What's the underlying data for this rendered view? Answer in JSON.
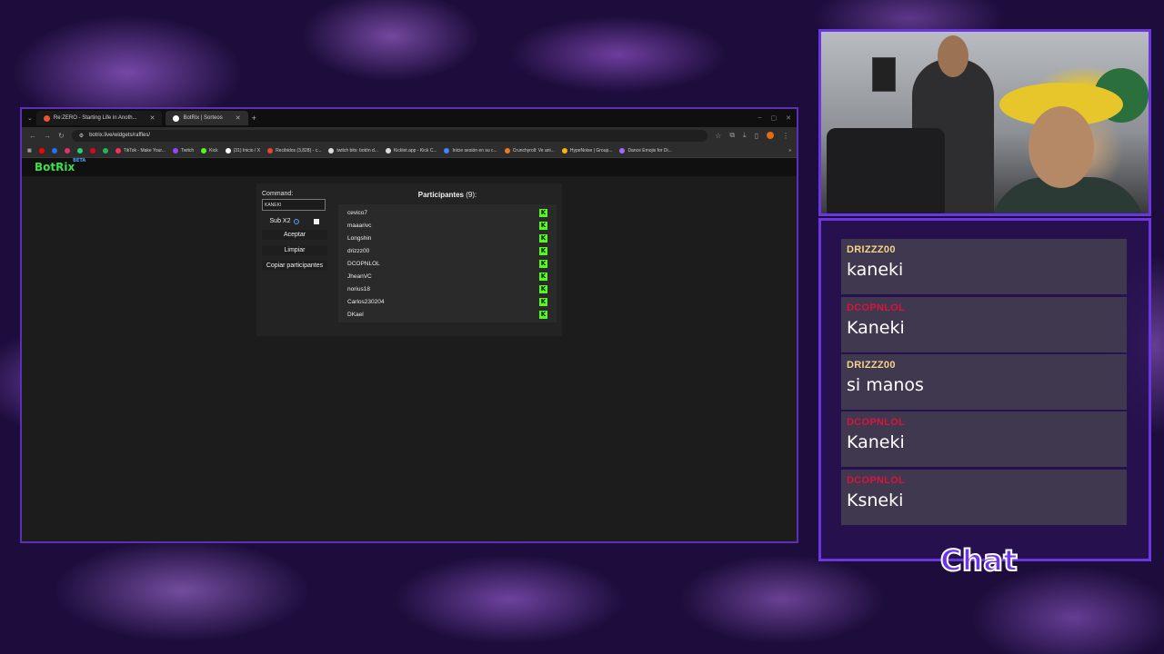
{
  "browser": {
    "tabs": [
      {
        "title": "Re:ZERO - Starting Life in Anoth...",
        "favicon_color": "#e8552b",
        "active": false
      },
      {
        "title": "BotRix | Sorteos",
        "favicon_color": "#ffffff",
        "active": true
      }
    ],
    "url": "botrix.live/widgets/raffles/",
    "bookmarks": [
      {
        "label": "TikTok - Make Your...",
        "color": "#ff2d55"
      },
      {
        "label": "Twitch",
        "color": "#9146ff"
      },
      {
        "label": "Kick",
        "color": "#53fc18"
      },
      {
        "label": "(31) Inicio / X",
        "color": "#ffffff"
      },
      {
        "label": "Recibidos (3,828) - c...",
        "color": "#ea4335"
      },
      {
        "label": "twitch bits: botón d...",
        "color": "#ffffff"
      },
      {
        "label": "Kicklet.app - Kick C...",
        "color": "#ffffff"
      },
      {
        "label": "Inicie sesión en su c...",
        "color": "#4285f4"
      },
      {
        "label": "Crunchyroll: Ve ani...",
        "color": "#f47521"
      },
      {
        "label": "HypeNoise | Group...",
        "color": "#ffb400"
      },
      {
        "label": "Dance Emojis for Di...",
        "color": "#a06cff"
      }
    ]
  },
  "site": {
    "logo": "BotRix",
    "logo_badge": "BETA"
  },
  "raffle": {
    "command_label": "Command:",
    "command_value": "KANEKI",
    "sub_label": "Sub X2",
    "accept_label": "Aceptar",
    "clear_label": "Limpiar",
    "copy_label": "Copiar participantes",
    "participants_title": "Participantes",
    "participants_count": "(9):",
    "participants": [
      "cevico7",
      "maaarivc",
      "Longshin",
      "drizzz00",
      "DCOPNLOL",
      "JheanVC",
      "norius18",
      "Carlos230204",
      "DKael"
    ]
  },
  "chat": {
    "title": "Chat",
    "messages": [
      {
        "user": "DRIZZZ00",
        "text": "kaneki",
        "color": "#f5d38a"
      },
      {
        "user": "DCOPNLOL",
        "text": "Kaneki",
        "color": "#d9143c"
      },
      {
        "user": "DRIZZZ00",
        "text": "si manos",
        "color": "#f5d38a"
      },
      {
        "user": "DCOPNLOL",
        "text": "Kaneki",
        "color": "#d9143c"
      },
      {
        "user": "DCOPNLOL",
        "text": "Ksneki",
        "color": "#d9143c"
      }
    ]
  },
  "colors": {
    "frame_purple": "#6a36e0",
    "kick_green": "#53fc18",
    "botrix_green": "#3ee04a"
  }
}
